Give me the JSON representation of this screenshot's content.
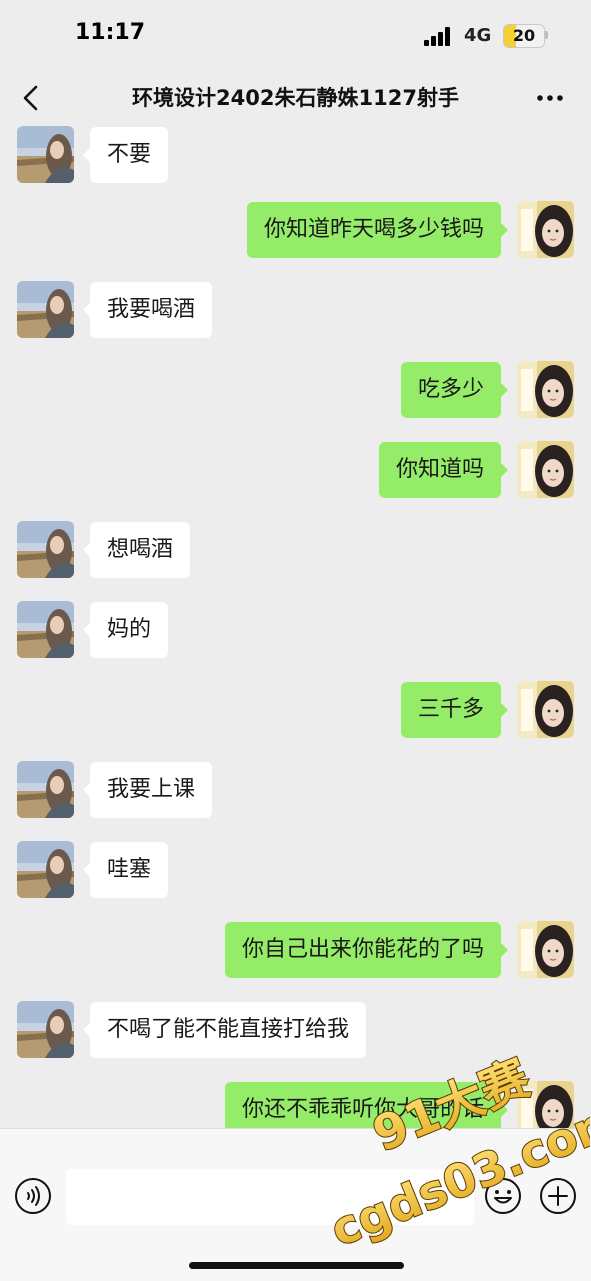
{
  "status_bar": {
    "time": "11:17",
    "network": "4G",
    "battery_percent": "20",
    "battery_color": "#f5cf33"
  },
  "header": {
    "title": "环境设计2402朱石静姝1127射手",
    "back_icon": "chevron-left-icon",
    "more_icon": "more-dots-icon"
  },
  "colors": {
    "outgoing_bubble": "#95ec69",
    "incoming_bubble": "#ffffff",
    "background": "#ededed"
  },
  "messages": [
    {
      "side": "in",
      "text": "不要"
    },
    {
      "side": "out",
      "text": "你知道昨天喝多少钱吗"
    },
    {
      "side": "in",
      "text": "我要喝酒"
    },
    {
      "side": "out",
      "text": "吃多少"
    },
    {
      "side": "out",
      "text": "你知道吗"
    },
    {
      "side": "in",
      "text": "想喝酒"
    },
    {
      "side": "in",
      "text": "妈的"
    },
    {
      "side": "out",
      "text": "三千多"
    },
    {
      "side": "in",
      "text": "我要上课"
    },
    {
      "side": "in",
      "text": "哇塞"
    },
    {
      "side": "out",
      "text": "你自己出来你能花的了吗"
    },
    {
      "side": "in",
      "text": "不喝了能不能直接打给我"
    },
    {
      "side": "out",
      "text": "你还不乖乖听你大哥的话"
    }
  ],
  "input_bar": {
    "placeholder": "",
    "voice_icon": "voice-icon",
    "emoji_icon": "emoji-icon",
    "plus_icon": "plus-icon"
  },
  "watermark": {
    "line1": "91大赛",
    "line2": "cgds03.com"
  }
}
